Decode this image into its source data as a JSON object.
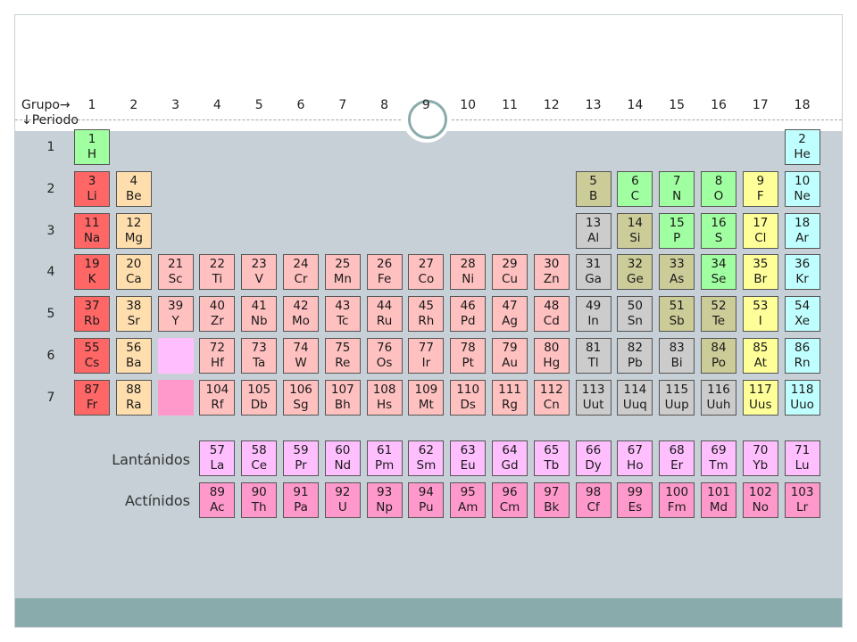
{
  "headers": {
    "group_label": "Grupo→",
    "period_label": "↓Periodo",
    "groups": [
      "1",
      "2",
      "3",
      "4",
      "5",
      "6",
      "7",
      "8",
      "9",
      "10",
      "11",
      "12",
      "13",
      "14",
      "15",
      "16",
      "17",
      "18"
    ],
    "periods": [
      "1",
      "2",
      "3",
      "4",
      "5",
      "6",
      "7"
    ]
  },
  "series_labels": {
    "lanthanides": "Lantánidos",
    "actinides": "Actínidos"
  },
  "colors": {
    "alkali": "#ff6666",
    "alkaline": "#ffdead",
    "transition": "#ffc0c0",
    "lanthanide": "#ffbfff",
    "actinide": "#ff99cc",
    "poor_metal": "#cccccc",
    "metalloid": "#cccc99",
    "nonmetal": "#a0ffa0",
    "halogen": "#ffff99",
    "noble": "#c0ffff",
    "band": "#c6d0d6",
    "footer": "#8aabab"
  },
  "elements": [
    {
      "n": "1",
      "s": "H",
      "p": 1,
      "g": 1,
      "c": "nonmetal"
    },
    {
      "n": "2",
      "s": "He",
      "p": 1,
      "g": 18,
      "c": "noble"
    },
    {
      "n": "3",
      "s": "Li",
      "p": 2,
      "g": 1,
      "c": "alkali"
    },
    {
      "n": "4",
      "s": "Be",
      "p": 2,
      "g": 2,
      "c": "alkaline"
    },
    {
      "n": "5",
      "s": "B",
      "p": 2,
      "g": 13,
      "c": "metalloid"
    },
    {
      "n": "6",
      "s": "C",
      "p": 2,
      "g": 14,
      "c": "nonmetal"
    },
    {
      "n": "7",
      "s": "N",
      "p": 2,
      "g": 15,
      "c": "nonmetal"
    },
    {
      "n": "8",
      "s": "O",
      "p": 2,
      "g": 16,
      "c": "nonmetal"
    },
    {
      "n": "9",
      "s": "F",
      "p": 2,
      "g": 17,
      "c": "halogen"
    },
    {
      "n": "10",
      "s": "Ne",
      "p": 2,
      "g": 18,
      "c": "noble"
    },
    {
      "n": "11",
      "s": "Na",
      "p": 3,
      "g": 1,
      "c": "alkali"
    },
    {
      "n": "12",
      "s": "Mg",
      "p": 3,
      "g": 2,
      "c": "alkaline"
    },
    {
      "n": "13",
      "s": "Al",
      "p": 3,
      "g": 13,
      "c": "poor_metal"
    },
    {
      "n": "14",
      "s": "Si",
      "p": 3,
      "g": 14,
      "c": "metalloid"
    },
    {
      "n": "15",
      "s": "P",
      "p": 3,
      "g": 15,
      "c": "nonmetal"
    },
    {
      "n": "16",
      "s": "S",
      "p": 3,
      "g": 16,
      "c": "nonmetal"
    },
    {
      "n": "17",
      "s": "Cl",
      "p": 3,
      "g": 17,
      "c": "halogen"
    },
    {
      "n": "18",
      "s": "Ar",
      "p": 3,
      "g": 18,
      "c": "noble"
    },
    {
      "n": "19",
      "s": "K",
      "p": 4,
      "g": 1,
      "c": "alkali"
    },
    {
      "n": "20",
      "s": "Ca",
      "p": 4,
      "g": 2,
      "c": "alkaline"
    },
    {
      "n": "21",
      "s": "Sc",
      "p": 4,
      "g": 3,
      "c": "transition"
    },
    {
      "n": "22",
      "s": "Ti",
      "p": 4,
      "g": 4,
      "c": "transition"
    },
    {
      "n": "23",
      "s": "V",
      "p": 4,
      "g": 5,
      "c": "transition"
    },
    {
      "n": "24",
      "s": "Cr",
      "p": 4,
      "g": 6,
      "c": "transition"
    },
    {
      "n": "25",
      "s": "Mn",
      "p": 4,
      "g": 7,
      "c": "transition"
    },
    {
      "n": "26",
      "s": "Fe",
      "p": 4,
      "g": 8,
      "c": "transition"
    },
    {
      "n": "27",
      "s": "Co",
      "p": 4,
      "g": 9,
      "c": "transition"
    },
    {
      "n": "28",
      "s": "Ni",
      "p": 4,
      "g": 10,
      "c": "transition"
    },
    {
      "n": "29",
      "s": "Cu",
      "p": 4,
      "g": 11,
      "c": "transition"
    },
    {
      "n": "30",
      "s": "Zn",
      "p": 4,
      "g": 12,
      "c": "transition"
    },
    {
      "n": "31",
      "s": "Ga",
      "p": 4,
      "g": 13,
      "c": "poor_metal"
    },
    {
      "n": "32",
      "s": "Ge",
      "p": 4,
      "g": 14,
      "c": "metalloid"
    },
    {
      "n": "33",
      "s": "As",
      "p": 4,
      "g": 15,
      "c": "metalloid"
    },
    {
      "n": "34",
      "s": "Se",
      "p": 4,
      "g": 16,
      "c": "nonmetal"
    },
    {
      "n": "35",
      "s": "Br",
      "p": 4,
      "g": 17,
      "c": "halogen"
    },
    {
      "n": "36",
      "s": "Kr",
      "p": 4,
      "g": 18,
      "c": "noble"
    },
    {
      "n": "37",
      "s": "Rb",
      "p": 5,
      "g": 1,
      "c": "alkali"
    },
    {
      "n": "38",
      "s": "Sr",
      "p": 5,
      "g": 2,
      "c": "alkaline"
    },
    {
      "n": "39",
      "s": "Y",
      "p": 5,
      "g": 3,
      "c": "transition"
    },
    {
      "n": "40",
      "s": "Zr",
      "p": 5,
      "g": 4,
      "c": "transition"
    },
    {
      "n": "41",
      "s": "Nb",
      "p": 5,
      "g": 5,
      "c": "transition"
    },
    {
      "n": "42",
      "s": "Mo",
      "p": 5,
      "g": 6,
      "c": "transition"
    },
    {
      "n": "43",
      "s": "Tc",
      "p": 5,
      "g": 7,
      "c": "transition"
    },
    {
      "n": "44",
      "s": "Ru",
      "p": 5,
      "g": 8,
      "c": "transition"
    },
    {
      "n": "45",
      "s": "Rh",
      "p": 5,
      "g": 9,
      "c": "transition"
    },
    {
      "n": "46",
      "s": "Pd",
      "p": 5,
      "g": 10,
      "c": "transition"
    },
    {
      "n": "47",
      "s": "Ag",
      "p": 5,
      "g": 11,
      "c": "transition"
    },
    {
      "n": "48",
      "s": "Cd",
      "p": 5,
      "g": 12,
      "c": "transition"
    },
    {
      "n": "49",
      "s": "In",
      "p": 5,
      "g": 13,
      "c": "poor_metal"
    },
    {
      "n": "50",
      "s": "Sn",
      "p": 5,
      "g": 14,
      "c": "poor_metal"
    },
    {
      "n": "51",
      "s": "Sb",
      "p": 5,
      "g": 15,
      "c": "metalloid"
    },
    {
      "n": "52",
      "s": "Te",
      "p": 5,
      "g": 16,
      "c": "metalloid"
    },
    {
      "n": "53",
      "s": "I",
      "p": 5,
      "g": 17,
      "c": "halogen"
    },
    {
      "n": "54",
      "s": "Xe",
      "p": 5,
      "g": 18,
      "c": "noble"
    },
    {
      "n": "55",
      "s": "Cs",
      "p": 6,
      "g": 1,
      "c": "alkali"
    },
    {
      "n": "56",
      "s": "Ba",
      "p": 6,
      "g": 2,
      "c": "alkaline"
    },
    {
      "n": "72",
      "s": "Hf",
      "p": 6,
      "g": 4,
      "c": "transition"
    },
    {
      "n": "73",
      "s": "Ta",
      "p": 6,
      "g": 5,
      "c": "transition"
    },
    {
      "n": "74",
      "s": "W",
      "p": 6,
      "g": 6,
      "c": "transition"
    },
    {
      "n": "75",
      "s": "Re",
      "p": 6,
      "g": 7,
      "c": "transition"
    },
    {
      "n": "76",
      "s": "Os",
      "p": 6,
      "g": 8,
      "c": "transition"
    },
    {
      "n": "77",
      "s": "Ir",
      "p": 6,
      "g": 9,
      "c": "transition"
    },
    {
      "n": "78",
      "s": "Pt",
      "p": 6,
      "g": 10,
      "c": "transition"
    },
    {
      "n": "79",
      "s": "Au",
      "p": 6,
      "g": 11,
      "c": "transition"
    },
    {
      "n": "80",
      "s": "Hg",
      "p": 6,
      "g": 12,
      "c": "transition"
    },
    {
      "n": "81",
      "s": "Tl",
      "p": 6,
      "g": 13,
      "c": "poor_metal"
    },
    {
      "n": "82",
      "s": "Pb",
      "p": 6,
      "g": 14,
      "c": "poor_metal"
    },
    {
      "n": "83",
      "s": "Bi",
      "p": 6,
      "g": 15,
      "c": "poor_metal"
    },
    {
      "n": "84",
      "s": "Po",
      "p": 6,
      "g": 16,
      "c": "metalloid"
    },
    {
      "n": "85",
      "s": "At",
      "p": 6,
      "g": 17,
      "c": "halogen"
    },
    {
      "n": "86",
      "s": "Rn",
      "p": 6,
      "g": 18,
      "c": "noble"
    },
    {
      "n": "87",
      "s": "Fr",
      "p": 7,
      "g": 1,
      "c": "alkali"
    },
    {
      "n": "88",
      "s": "Ra",
      "p": 7,
      "g": 2,
      "c": "alkaline"
    },
    {
      "n": "104",
      "s": "Rf",
      "p": 7,
      "g": 4,
      "c": "transition"
    },
    {
      "n": "105",
      "s": "Db",
      "p": 7,
      "g": 5,
      "c": "transition"
    },
    {
      "n": "106",
      "s": "Sg",
      "p": 7,
      "g": 6,
      "c": "transition"
    },
    {
      "n": "107",
      "s": "Bh",
      "p": 7,
      "g": 7,
      "c": "transition"
    },
    {
      "n": "108",
      "s": "Hs",
      "p": 7,
      "g": 8,
      "c": "transition"
    },
    {
      "n": "109",
      "s": "Mt",
      "p": 7,
      "g": 9,
      "c": "transition"
    },
    {
      "n": "110",
      "s": "Ds",
      "p": 7,
      "g": 10,
      "c": "transition"
    },
    {
      "n": "111",
      "s": "Rg",
      "p": 7,
      "g": 11,
      "c": "transition"
    },
    {
      "n": "112",
      "s": "Cn",
      "p": 7,
      "g": 12,
      "c": "transition"
    },
    {
      "n": "113",
      "s": "Uut",
      "p": 7,
      "g": 13,
      "c": "poor_metal"
    },
    {
      "n": "114",
      "s": "Uuq",
      "p": 7,
      "g": 14,
      "c": "poor_metal"
    },
    {
      "n": "115",
      "s": "Uup",
      "p": 7,
      "g": 15,
      "c": "poor_metal"
    },
    {
      "n": "116",
      "s": "Uuh",
      "p": 7,
      "g": 16,
      "c": "poor_metal"
    },
    {
      "n": "117",
      "s": "Uus",
      "p": 7,
      "g": 17,
      "c": "halogen"
    },
    {
      "n": "118",
      "s": "Uuo",
      "p": 7,
      "g": 18,
      "c": "noble"
    }
  ],
  "placeholders": [
    {
      "p": 6,
      "g": 3,
      "c": "lanthanide"
    },
    {
      "p": 7,
      "g": 3,
      "c": "actinide"
    }
  ],
  "lanthanides": [
    {
      "n": "57",
      "s": "La"
    },
    {
      "n": "58",
      "s": "Ce"
    },
    {
      "n": "59",
      "s": "Pr"
    },
    {
      "n": "60",
      "s": "Nd"
    },
    {
      "n": "61",
      "s": "Pm"
    },
    {
      "n": "62",
      "s": "Sm"
    },
    {
      "n": "63",
      "s": "Eu"
    },
    {
      "n": "64",
      "s": "Gd"
    },
    {
      "n": "65",
      "s": "Tb"
    },
    {
      "n": "66",
      "s": "Dy"
    },
    {
      "n": "67",
      "s": "Ho"
    },
    {
      "n": "68",
      "s": "Er"
    },
    {
      "n": "69",
      "s": "Tm"
    },
    {
      "n": "70",
      "s": "Yb"
    },
    {
      "n": "71",
      "s": "Lu"
    }
  ],
  "actinides": [
    {
      "n": "89",
      "s": "Ac"
    },
    {
      "n": "90",
      "s": "Th"
    },
    {
      "n": "91",
      "s": "Pa"
    },
    {
      "n": "92",
      "s": "U"
    },
    {
      "n": "93",
      "s": "Np"
    },
    {
      "n": "94",
      "s": "Pu"
    },
    {
      "n": "95",
      "s": "Am"
    },
    {
      "n": "96",
      "s": "Cm"
    },
    {
      "n": "97",
      "s": "Bk"
    },
    {
      "n": "98",
      "s": "Cf"
    },
    {
      "n": "99",
      "s": "Es"
    },
    {
      "n": "100",
      "s": "Fm"
    },
    {
      "n": "101",
      "s": "Md"
    },
    {
      "n": "102",
      "s": "No"
    },
    {
      "n": "103",
      "s": "Lr"
    }
  ]
}
